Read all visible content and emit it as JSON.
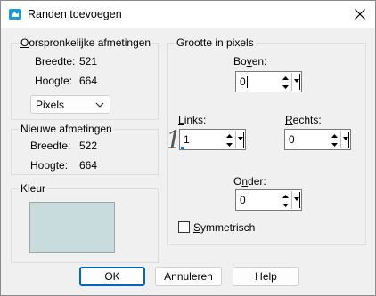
{
  "window": {
    "title": "Randen toevoegen",
    "accent": "#0078d7"
  },
  "original": {
    "group_label": "Oorspronkelijke afmetingen",
    "width_label": "Breedte:",
    "width_value": "521",
    "height_label": "Hoogte:",
    "height_value": "664",
    "unit_select": "Pixels"
  },
  "new": {
    "group_label": "Nieuwe afmetingen",
    "width_label": "Breedte:",
    "width_value": "522",
    "height_label": "Hoogte:",
    "height_value": "664"
  },
  "color": {
    "group_label": "Kleur",
    "swatch_color": "#c9dcdd"
  },
  "border": {
    "group_label": "Grootte in pixels",
    "top_label": "Boven:",
    "top_value": "0",
    "left_label": "Links:",
    "left_value": "1",
    "right_label": "Rechts:",
    "right_value": "0",
    "bottom_label": "Onder:",
    "bottom_value": "0",
    "symmetric_label": "Symmetrisch",
    "symmetric_checked": false
  },
  "buttons": {
    "ok": "OK",
    "cancel": "Annuleren",
    "help": "Help"
  },
  "icons": {
    "title": "paint-shop-icon",
    "close": "close-icon",
    "select": "chevron-down-icon",
    "spin_up": "spin-up-icon",
    "spin_down": "spin-down-icon",
    "spin_drop": "dropdown-arrow-icon"
  }
}
